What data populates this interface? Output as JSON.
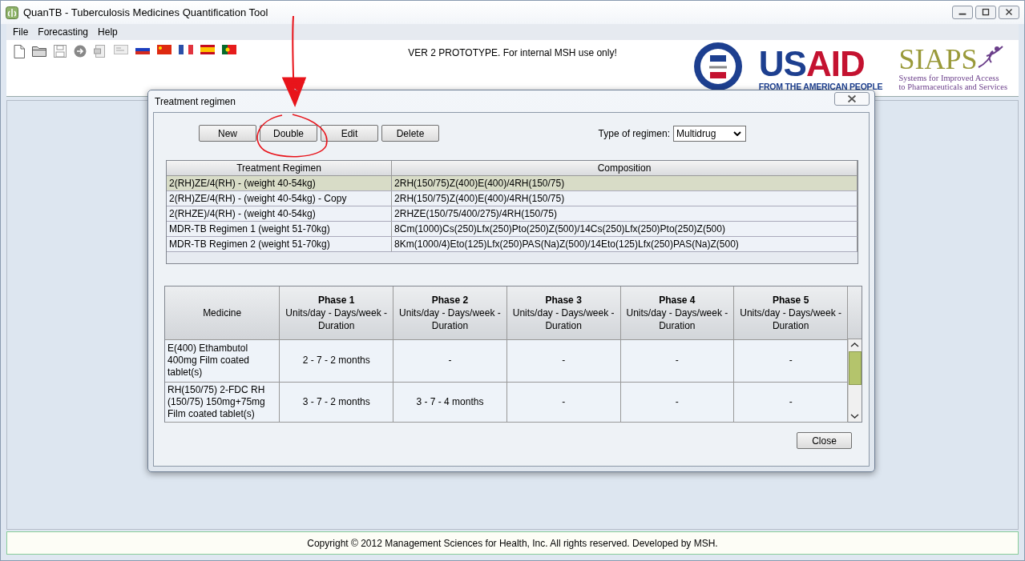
{
  "window": {
    "title": "QuanTB - Tuberculosis Medicines Quantification Tool"
  },
  "menu": [
    "File",
    "Forecasting",
    "Help"
  ],
  "banner_text": "VER 2 PROTOTYPE. For internal MSH use only!",
  "logos": {
    "usaid": {
      "wordmark": "USAID",
      "tagline": "FROM THE AMERICAN PEOPLE"
    },
    "siaps": {
      "wordmark": "SIAPS",
      "tagline": [
        "Systems for Improved Access",
        "to Pharmaceuticals and Services"
      ]
    }
  },
  "dialog": {
    "title": "Treatment regimen",
    "buttons": [
      "New",
      "Double",
      "Edit",
      "Delete"
    ],
    "regimen_type": {
      "label": "Type of regimen:",
      "value": "Multidrug"
    },
    "regimens": {
      "columns": [
        "Treatment Regimen",
        "Composition"
      ],
      "rows": [
        {
          "name": "2(RH)ZE/4(RH) - (weight 40-54kg)",
          "composition": "2RH(150/75)Z(400)E(400)/4RH(150/75)",
          "selected": true
        },
        {
          "name": "2(RH)ZE/4(RH) - (weight 40-54kg) - Copy",
          "composition": "2RH(150/75)Z(400)E(400)/4RH(150/75)",
          "selected": false
        },
        {
          "name": "2(RHZE)/4(RH) - (weight 40-54kg)",
          "composition": "2RHZE(150/75/400/275)/4RH(150/75)",
          "selected": false
        },
        {
          "name": "MDR-TB Regimen 1 (weight 51-70kg)",
          "composition": "8Cm(1000)Cs(250)Lfx(250)Pto(250)Z(500)/14Cs(250)Lfx(250)Pto(250)Z(500)",
          "selected": false
        },
        {
          "name": "MDR-TB Regimen 2 (weight 51-70kg)",
          "composition": "8Km(1000/4)Eto(125)Lfx(250)PAS(Na)Z(500)/14Eto(125)Lfx(250)PAS(Na)Z(500)",
          "selected": false
        }
      ]
    },
    "medicines": {
      "columns": [
        {
          "title": "Medicine"
        },
        {
          "title": "Phase 1",
          "subtitle": "Units/day - Days/week - Duration"
        },
        {
          "title": "Phase 2",
          "subtitle": "Units/day - Days/week - Duration"
        },
        {
          "title": "Phase 3",
          "subtitle": "Units/day - Days/week - Duration"
        },
        {
          "title": "Phase 4",
          "subtitle": "Units/day - Days/week - Duration"
        },
        {
          "title": "Phase 5",
          "subtitle": "Units/day - Days/week - Duration"
        }
      ],
      "rows": [
        {
          "medicine": "E(400)  Ethambutol 400mg  Film coated tablet(s)",
          "phases": [
            "2 - 7 - 2 months",
            "-",
            "-",
            "-",
            "-"
          ]
        },
        {
          "medicine": "RH(150/75)  2-FDC RH (150/75)  150mg+75mg Film coated tablet(s)",
          "phases": [
            "3 - 7 - 2 months",
            "3 - 7 - 4 months",
            "-",
            "-",
            "-"
          ]
        }
      ]
    },
    "close_button": "Close"
  },
  "footer": "Copyright © 2012 Management Sciences for Health, Inc. All rights reserved. Developed by MSH."
}
